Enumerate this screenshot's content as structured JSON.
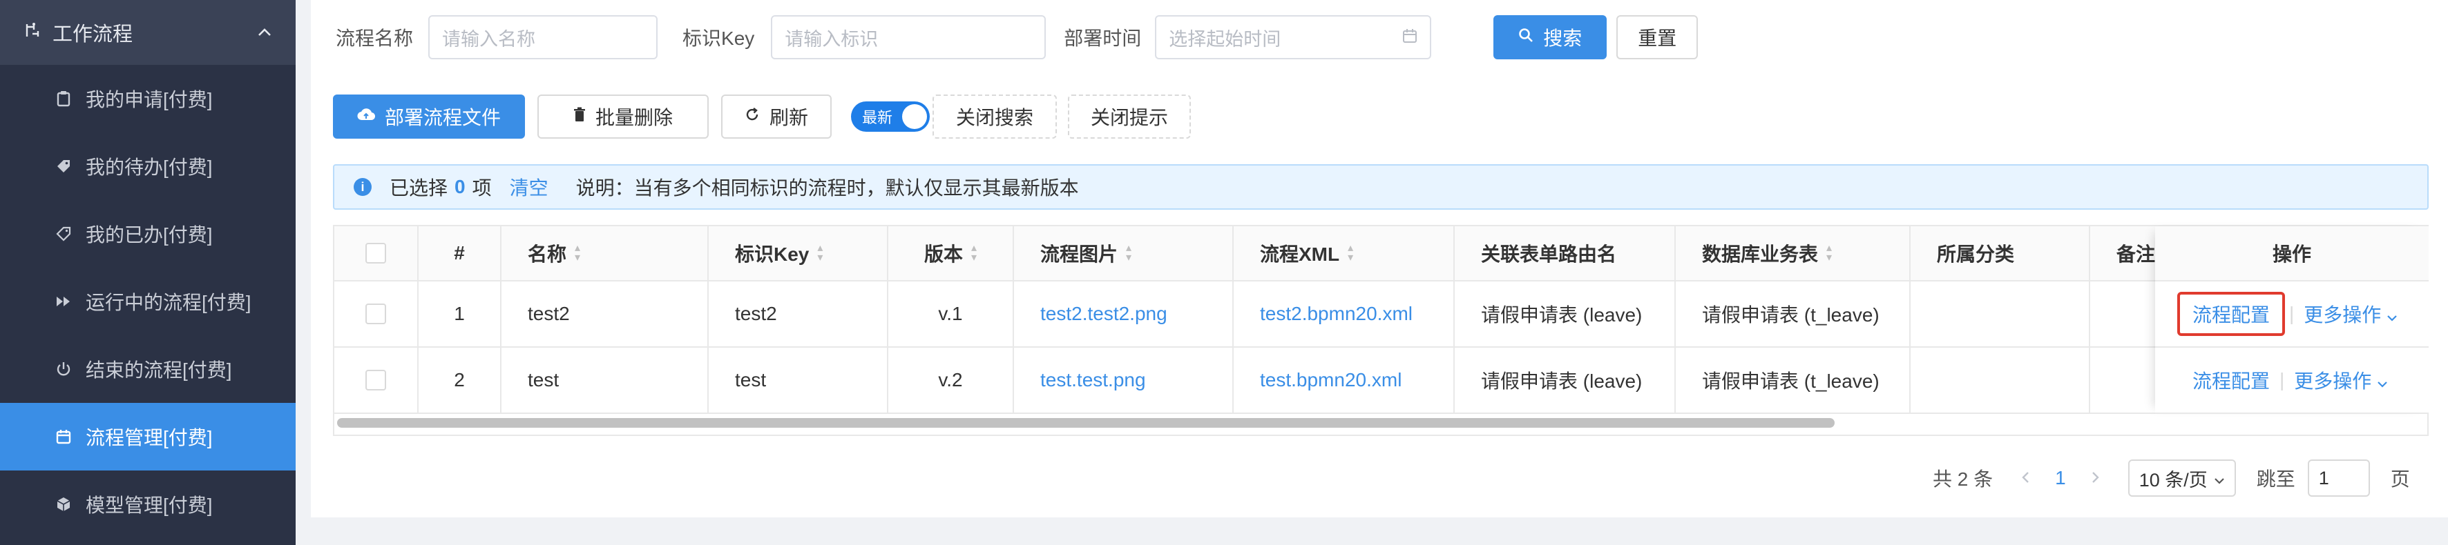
{
  "sidebar": {
    "header": "工作流程",
    "items": [
      {
        "label": "我的申请[付费]",
        "icon": "clipboard-icon"
      },
      {
        "label": "我的待办[付费]",
        "icon": "tag-icon"
      },
      {
        "label": "我的已办[付费]",
        "icon": "tag-outline-icon"
      },
      {
        "label": "运行中的流程[付费]",
        "icon": "fast-forward-icon"
      },
      {
        "label": "结束的流程[付费]",
        "icon": "power-icon"
      },
      {
        "label": "流程管理[付费]",
        "icon": "calendar-icon",
        "active": true
      },
      {
        "label": "模型管理[付费]",
        "icon": "cube-icon"
      }
    ]
  },
  "search": {
    "name_label": "流程名称",
    "name_placeholder": "请输入名称",
    "key_label": "标识Key",
    "key_placeholder": "请输入标识",
    "time_label": "部署时间",
    "time_placeholder": "选择起始时间",
    "search_btn": "搜索",
    "reset_btn": "重置"
  },
  "toolbar": {
    "deploy": "部署流程文件",
    "batch_delete": "批量删除",
    "refresh": "刷新",
    "switch_label": "最新",
    "close_search": "关闭搜索",
    "close_tip": "关闭提示"
  },
  "alert": {
    "selected_prefix": "已选择",
    "selected_count": "0",
    "selected_suffix": "项",
    "clear": "清空",
    "note": "说明：当有多个相同标识的流程时，默认仅显示其最新版本"
  },
  "table": {
    "headers": {
      "index": "#",
      "name": "名称",
      "key": "标识Key",
      "version": "版本",
      "image": "流程图片",
      "xml": "流程XML",
      "route": "关联表单路由名",
      "biz_table": "数据库业务表",
      "category": "所属分类",
      "remark": "备注",
      "ops": "操作"
    },
    "rows": [
      {
        "index": "1",
        "name": "test2",
        "key": "test2",
        "version": "v.1",
        "image": "test2.test2.png",
        "xml": "test2.bpmn20.xml",
        "route": "请假申请表 (leave)",
        "biz_table": "请假申请表 (t_leave)",
        "config": "流程配置",
        "more": "更多操作"
      },
      {
        "index": "2",
        "name": "test",
        "key": "test",
        "version": "v.2",
        "image": "test.test.png",
        "xml": "test.bpmn20.xml",
        "route": "请假申请表 (leave)",
        "biz_table": "请假申请表 (t_leave)",
        "config": "流程配置",
        "more": "更多操作"
      }
    ]
  },
  "pagination": {
    "total": "共 2 条",
    "current": "1",
    "page_size": "10 条/页",
    "jump_label": "跳至",
    "jump_value": "1",
    "page_suffix": "页"
  },
  "colors": {
    "primary": "#3a8ee6",
    "sidebar_bg": "#2b3245",
    "highlight": "#e03b2e"
  }
}
